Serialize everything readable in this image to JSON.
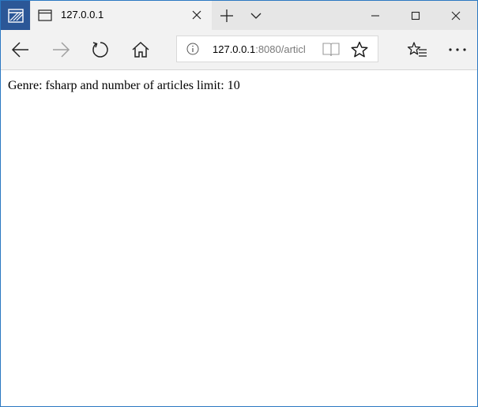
{
  "tab": {
    "title": "127.0.0.1"
  },
  "address_bar": {
    "url_host": "127.0.0.1",
    "url_rest": ":8080/articl"
  },
  "page": {
    "text": "Genre: fsharp and number of articles limit: 10"
  },
  "colors": {
    "accent": "#2b5797",
    "tab_bar": "#e6e6e6",
    "toolbar": "#f2f2f2",
    "url_muted": "#7a7a7a",
    "forward_disabled": "#a0a0a0"
  },
  "icons": {
    "app": "browser-app-icon",
    "tab": "tab-page-icon",
    "tab_close": "close-icon",
    "new_tab": "plus-icon",
    "tab_list": "chevron-down-icon",
    "minimize": "minimize-icon",
    "maximize": "maximize-icon",
    "close": "close-icon",
    "back": "back-arrow-icon",
    "forward": "forward-arrow-icon",
    "refresh": "refresh-icon",
    "home": "home-icon",
    "info": "info-icon",
    "reading_view": "reading-view-icon",
    "favorite": "star-icon",
    "favorites_hub": "favorites-list-icon",
    "more": "more-icon"
  }
}
